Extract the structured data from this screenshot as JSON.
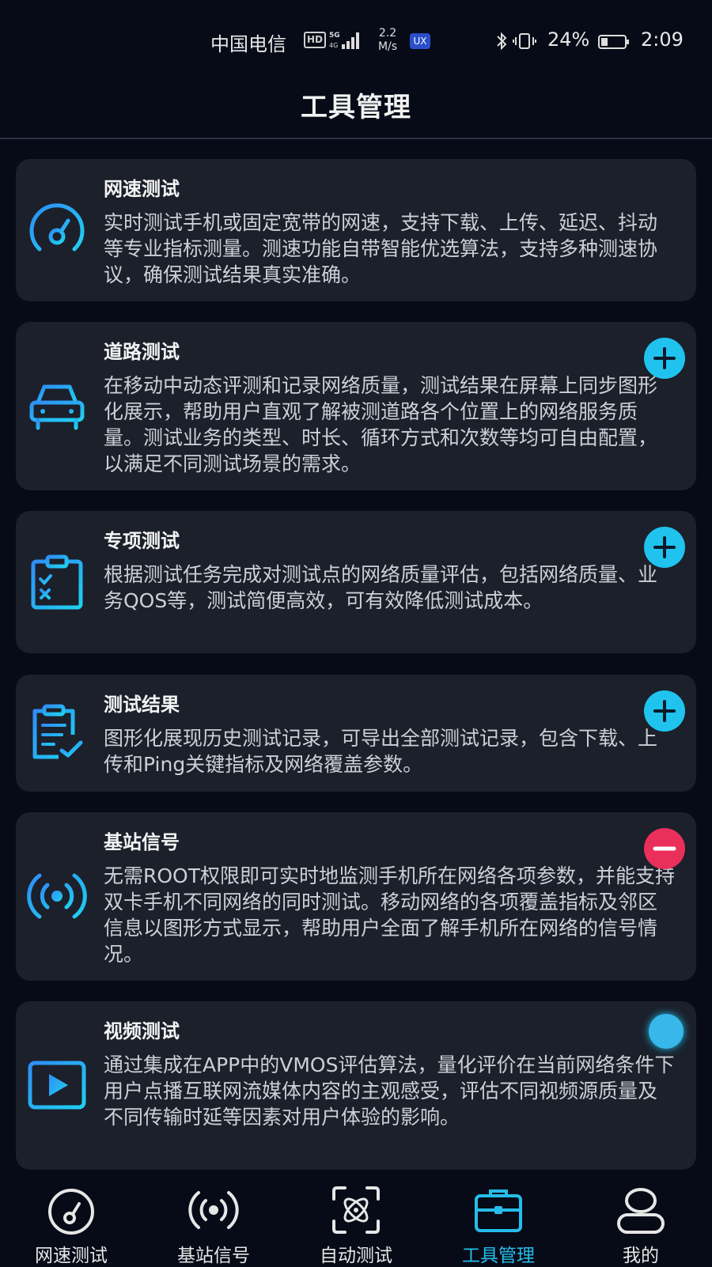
{
  "status_bar": {
    "carrier": "中国电信",
    "hd_badge": "HD",
    "net_speed_value": "2.2",
    "net_speed_unit": "M/s",
    "ux_badge": "UX",
    "battery_percent": "24%",
    "time": "2:09"
  },
  "header": {
    "title": "工具管理"
  },
  "cards": [
    {
      "title": "网速测试",
      "description": "实时测试手机或固定宽带的网速，支持下载、上传、延迟、抖动等专业指标测量。测速功能自带智能优选算法，支持多种测速协议，确保测试结果真实准确。",
      "icon": "speedometer-icon",
      "action": "none"
    },
    {
      "title": "道路测试",
      "description": "在移动中动态评测和记录网络质量，测试结果在屏幕上同步图形化展示，帮助用户直观了解被测道路各个位置上的网络服务质量。测试业务的类型、时长、循环方式和次数等均可自由配置，以满足不同测试场景的需求。",
      "icon": "car-icon",
      "action": "add"
    },
    {
      "title": "专项测试",
      "description": "根据测试任务完成对测试点的网络质量评估，包括网络质量、业务QOS等，测试简便高效，可有效降低测试成本。",
      "icon": "clipboard-check-icon",
      "action": "add"
    },
    {
      "title": "测试结果",
      "description": "图形化展现历史测试记录，可导出全部测试记录，包含下载、上传和Ping关键指标及网络覆盖参数。",
      "icon": "document-check-icon",
      "action": "add"
    },
    {
      "title": "基站信号",
      "description": "无需ROOT权限即可实时地监测手机所在网络各项参数，并能支持双卡手机不同网络的同时测试。移动网络的各项覆盖指标及邻区信息以图形方式显示，帮助用户全面了解手机所在网络的信号情况。",
      "icon": "signal-broadcast-icon",
      "action": "remove"
    },
    {
      "title": "视频测试",
      "description": "通过集成在APP中的VMOS评估算法，量化评价在当前网络条件下用户点播互联网流媒体内容的主观感受，评估不同视频源质量及不同传输时延等因素对用户体验的影响。",
      "icon": "video-play-icon",
      "action": "toggle"
    }
  ],
  "bottom_nav": [
    {
      "label": "网速测试",
      "icon": "speedometer-icon",
      "active": false
    },
    {
      "label": "基站信号",
      "icon": "signal-broadcast-icon",
      "active": false
    },
    {
      "label": "自动测试",
      "icon": "scan-atom-icon",
      "active": false
    },
    {
      "label": "工具管理",
      "icon": "toolbox-icon",
      "active": true
    },
    {
      "label": "我的",
      "icon": "user-icon",
      "active": false
    }
  ],
  "colors": {
    "background": "#070b17",
    "card": "#1b202b",
    "accent": "#1fc3ee",
    "remove": "#ea2f5a"
  }
}
